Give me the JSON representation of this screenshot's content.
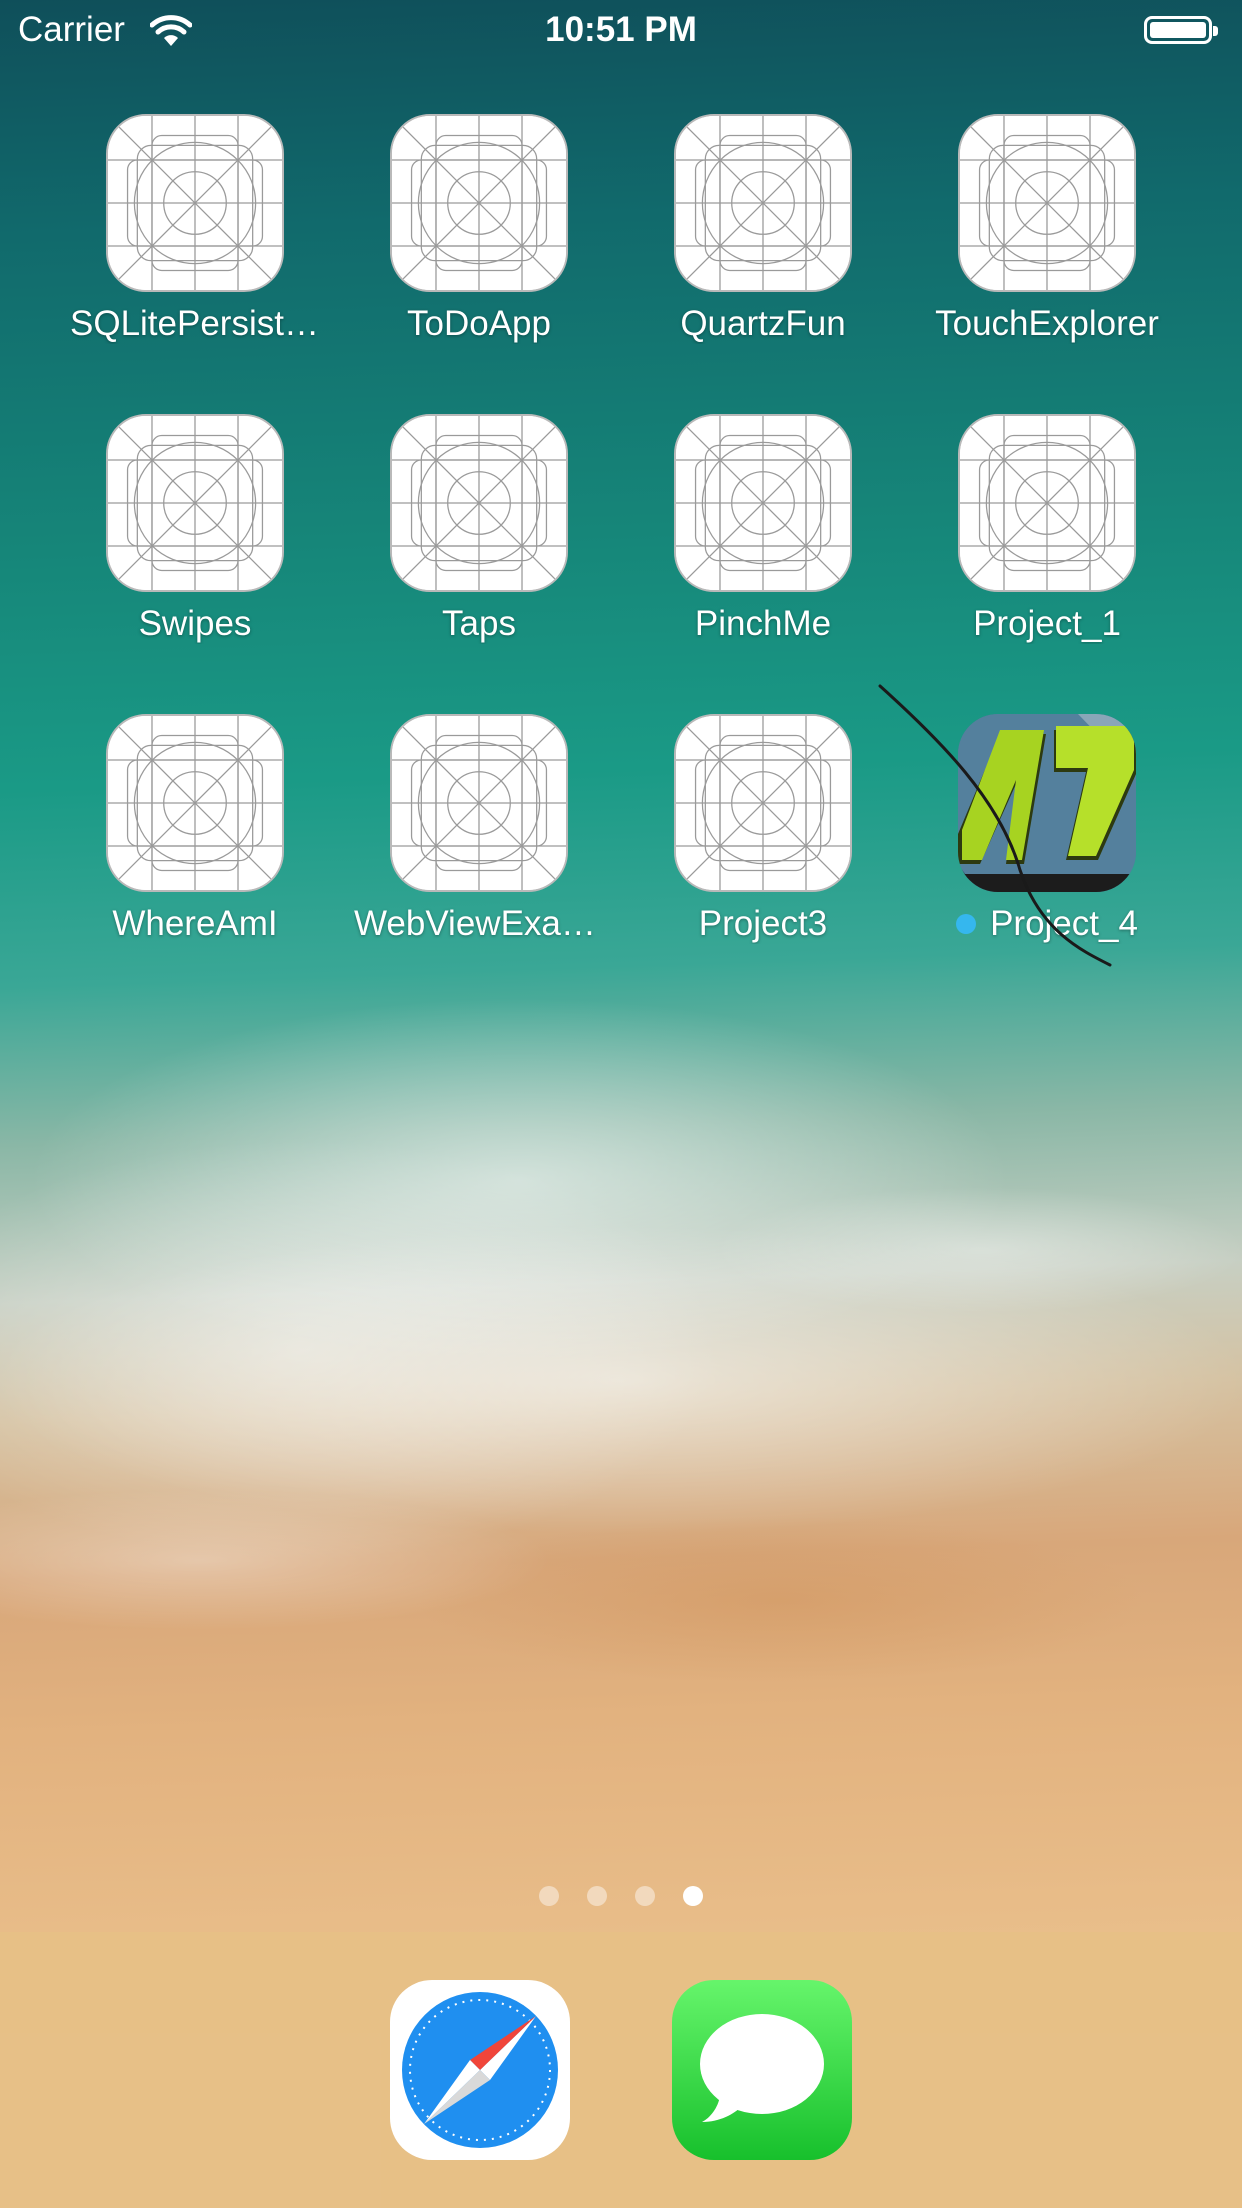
{
  "status_bar": {
    "carrier": "Carrier",
    "time": "10:51 PM"
  },
  "apps": [
    {
      "label": "SQLitePersiste...",
      "icon": "placeholder-app-icon"
    },
    {
      "label": "ToDoApp",
      "icon": "placeholder-app-icon"
    },
    {
      "label": "QuartzFun",
      "icon": "placeholder-app-icon"
    },
    {
      "label": "TouchExplorer",
      "icon": "placeholder-app-icon"
    },
    {
      "label": "Swipes",
      "icon": "placeholder-app-icon"
    },
    {
      "label": "Taps",
      "icon": "placeholder-app-icon"
    },
    {
      "label": "PinchMe",
      "icon": "placeholder-app-icon"
    },
    {
      "label": "Project_1",
      "icon": "placeholder-app-icon"
    },
    {
      "label": "WhereAmI",
      "icon": "placeholder-app-icon"
    },
    {
      "label": "WebViewExam...",
      "icon": "placeholder-app-icon"
    },
    {
      "label": "Project3",
      "icon": "placeholder-app-icon"
    },
    {
      "label": "Project_4",
      "icon": "nv-logo-icon",
      "new": true
    }
  ],
  "page_indicator": {
    "count": 4,
    "current": 4
  },
  "dock": [
    {
      "name": "Safari",
      "icon": "safari-compass-icon"
    },
    {
      "name": "Messages",
      "icon": "messages-bubble-icon"
    }
  ],
  "colors": {
    "new_dot": "#35b7ee",
    "dock_bg": "#f8c487",
    "messages_green": "#3ec93a",
    "safari_blue": "#1f8ff0"
  }
}
